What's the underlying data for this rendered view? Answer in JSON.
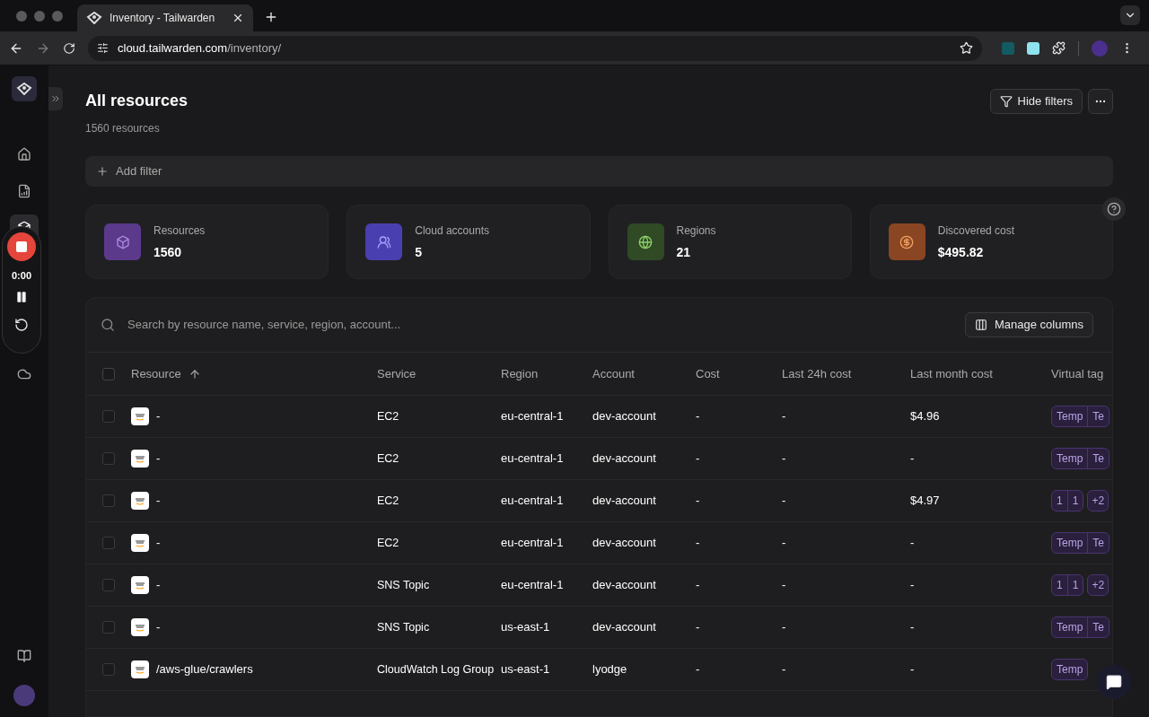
{
  "browser": {
    "tab_title": "Inventory - Tailwarden",
    "url_host": "cloud.tailwarden.com",
    "url_path": "/inventory/"
  },
  "sidebar": {
    "items": [
      {
        "kind": "home",
        "selected": false
      },
      {
        "kind": "report",
        "selected": false
      },
      {
        "kind": "inventory",
        "selected": true
      },
      {
        "kind": "cloud",
        "selected": false
      }
    ]
  },
  "recorder": {
    "time": "0:00"
  },
  "header": {
    "title": "All resources",
    "subtitle": "1560 resources",
    "buttons": [
      "Hide filters"
    ]
  },
  "filter_bar": {
    "label": "Add filter"
  },
  "stats": [
    {
      "kind": "cube",
      "label": "Resources",
      "value": "1560",
      "color": "#5b3a8c"
    },
    {
      "kind": "accounts",
      "label": "Cloud accounts",
      "value": "5",
      "color": "#4a3fb0"
    },
    {
      "kind": "globe",
      "label": "Regions",
      "value": "21",
      "color": "#2f4a25"
    },
    {
      "kind": "dollar",
      "label": "Discovered cost",
      "value": "$495.82",
      "color": "#8a4622"
    }
  ],
  "table": {
    "search_placeholder": "Search by resource name, service, region, account...",
    "manage_label": "Manage columns",
    "select_all_checked": false,
    "columns": [
      "Resource",
      "Service",
      "Region",
      "Account",
      "Cost",
      "Last 24h cost",
      "Last month cost",
      "Virtual tag"
    ],
    "rows": [
      {
        "checked": false,
        "resource": "-",
        "service": "EC2",
        "region": "eu-central-1",
        "account": "dev-account",
        "cost": "-",
        "last_24h": "-",
        "last_month": "$4.96",
        "tags": [
          "Temp",
          "Te"
        ]
      },
      {
        "checked": false,
        "resource": "-",
        "service": "EC2",
        "region": "eu-central-1",
        "account": "dev-account",
        "cost": "-",
        "last_24h": "-",
        "last_month": "-",
        "tags": [
          "Temp",
          "Te"
        ]
      },
      {
        "checked": false,
        "resource": "-",
        "service": "EC2",
        "region": "eu-central-1",
        "account": "dev-account",
        "cost": "-",
        "last_24h": "-",
        "last_month": "$4.97",
        "tags": [
          "1",
          "1"
        ],
        "more": "+2"
      },
      {
        "checked": false,
        "resource": "-",
        "service": "EC2",
        "region": "eu-central-1",
        "account": "dev-account",
        "cost": "-",
        "last_24h": "-",
        "last_month": "-",
        "tags": [
          "Temp",
          "Te"
        ]
      },
      {
        "checked": false,
        "resource": "-",
        "service": "SNS Topic",
        "region": "eu-central-1",
        "account": "dev-account",
        "cost": "-",
        "last_24h": "-",
        "last_month": "-",
        "tags": [
          "1",
          "1"
        ],
        "more": "+2"
      },
      {
        "checked": false,
        "resource": "-",
        "service": "SNS Topic",
        "region": "us-east-1",
        "account": "dev-account",
        "cost": "-",
        "last_24h": "-",
        "last_month": "-",
        "tags": [
          "Temp",
          "Te"
        ]
      },
      {
        "checked": false,
        "resource": "/aws-glue/crawlers",
        "service": "CloudWatch Log Group",
        "region": "us-east-1",
        "account": "lyodge",
        "cost": "-",
        "last_24h": "-",
        "last_month": "-",
        "tags": [
          "Temp"
        ]
      }
    ]
  }
}
